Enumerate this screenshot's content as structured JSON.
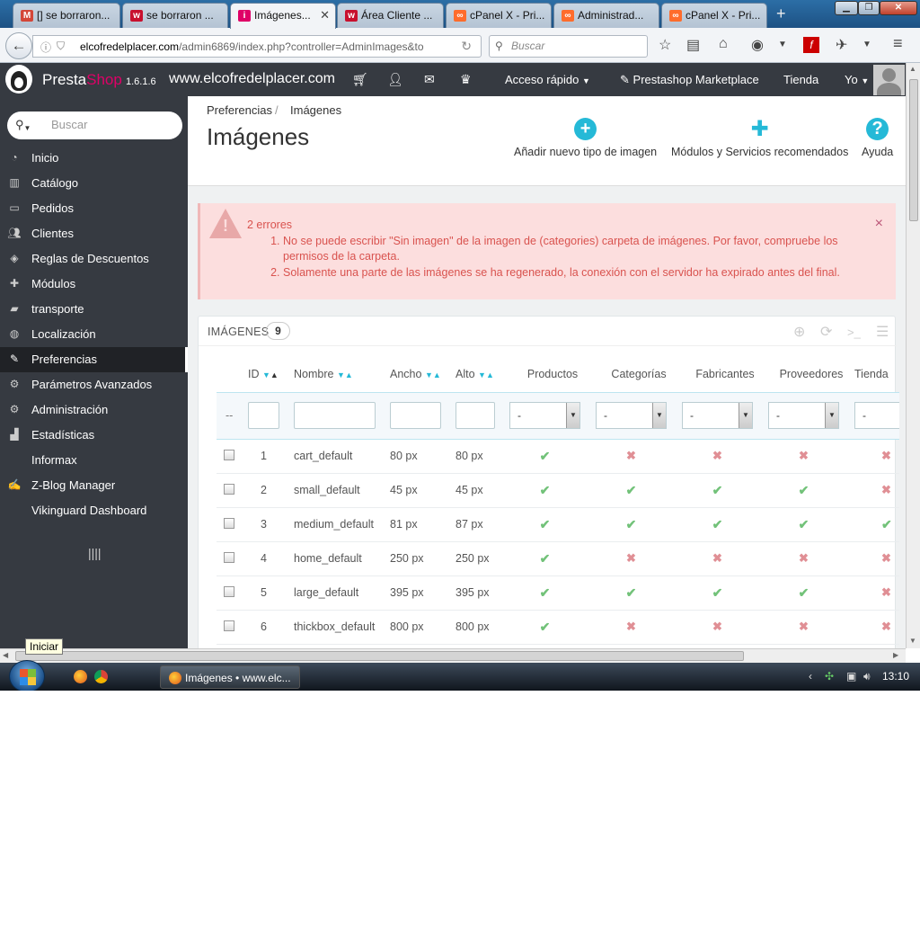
{
  "browser": {
    "tabs": [
      {
        "label": "[] se borraron...",
        "favicon": "gmail-icon",
        "color": "#d44638"
      },
      {
        "label": "se borraron ...",
        "favicon": "w-icon",
        "color": "#c8102e"
      },
      {
        "label": "Imágenes...",
        "favicon": "prestashop-icon",
        "color": "#df0067",
        "active": true
      },
      {
        "label": "Área Cliente ...",
        "favicon": "w-icon",
        "color": "#c8102e"
      },
      {
        "label": "cPanel X - Pri...",
        "favicon": "cpanel-icon",
        "color": "#ff6c2c"
      },
      {
        "label": "Administrad...",
        "favicon": "cpanel-icon",
        "color": "#ff6c2c"
      },
      {
        "label": "cPanel X - Pri...",
        "favicon": "cpanel-icon",
        "color": "#ff6c2c"
      }
    ],
    "url_domain": "elcofredelplacer.com",
    "url_path": "/admin6869/index.php?controller=AdminImages&to",
    "search_placeholder": "Buscar"
  },
  "header": {
    "brand_a": "Presta",
    "brand_b": "Shop",
    "version": "1.6.1.6",
    "site": "www.elcofredelplacer.com",
    "quick_access": "Acceso rápido",
    "marketplace": "Prestashop Marketplace",
    "store": "Tienda",
    "me": "Yo"
  },
  "sidebar": {
    "search_placeholder": "Buscar",
    "items": [
      {
        "label": "Inicio",
        "icon": "dashboard-icon"
      },
      {
        "label": "Catálogo",
        "icon": "book-icon"
      },
      {
        "label": "Pedidos",
        "icon": "credit-card-icon"
      },
      {
        "label": "Clientes",
        "icon": "users-icon"
      },
      {
        "label": "Reglas de Descuentos",
        "icon": "tags-icon"
      },
      {
        "label": "Módulos",
        "icon": "puzzle-icon"
      },
      {
        "label": "transporte",
        "icon": "truck-icon"
      },
      {
        "label": "Localización",
        "icon": "globe-icon"
      },
      {
        "label": "Preferencias",
        "icon": "wrench-icon",
        "active": true
      },
      {
        "label": "Parámetros Avanzados",
        "icon": "cogs-icon"
      },
      {
        "label": "Administración",
        "icon": "cog-icon"
      },
      {
        "label": "Estadísticas",
        "icon": "bar-chart-icon"
      },
      {
        "label": "Informax",
        "icon": ""
      },
      {
        "label": "Z-Blog Manager",
        "icon": "edit-icon"
      },
      {
        "label": "Vikinguard Dashboard",
        "icon": ""
      }
    ]
  },
  "page": {
    "breadcrumb": [
      "Preferencias",
      "Imágenes"
    ],
    "title": "Imágenes",
    "toolbar": {
      "add": "Añadir nuevo tipo de imagen",
      "modules": "Módulos y Servicios recomendados",
      "help": "Ayuda"
    }
  },
  "alert": {
    "count": "2 errores",
    "errors": [
      "No se puede escribir \"Sin imagen\" de la imagen de (categories) carpeta de imágenes. Por favor, compruebe los permisos de la carpeta.",
      "Solamente una parte de las imágenes se ha regenerado, la conexión con el servidor ha expirado antes del final."
    ]
  },
  "table": {
    "title": "IMÁGENES",
    "count": "9",
    "columns": [
      "ID",
      "Nombre",
      "Ancho",
      "Alto",
      "Productos",
      "Categorías",
      "Fabricantes",
      "Proveedores",
      "Tienda"
    ],
    "filter_dash": "--",
    "select_default": "-",
    "rows": [
      {
        "id": "1",
        "name": "cart_default",
        "width": "80 px",
        "height": "80 px",
        "flags": [
          true,
          false,
          false,
          false,
          false
        ]
      },
      {
        "id": "2",
        "name": "small_default",
        "width": "45 px",
        "height": "45 px",
        "flags": [
          true,
          true,
          true,
          true,
          false
        ]
      },
      {
        "id": "3",
        "name": "medium_default",
        "width": "81 px",
        "height": "87 px",
        "flags": [
          true,
          true,
          true,
          true,
          true
        ]
      },
      {
        "id": "4",
        "name": "home_default",
        "width": "250 px",
        "height": "250 px",
        "flags": [
          true,
          false,
          false,
          false,
          false
        ]
      },
      {
        "id": "5",
        "name": "large_default",
        "width": "395 px",
        "height": "395 px",
        "flags": [
          true,
          true,
          true,
          true,
          false
        ]
      },
      {
        "id": "6",
        "name": "thickbox_default",
        "width": "800 px",
        "height": "800 px",
        "flags": [
          true,
          false,
          false,
          false,
          false
        ]
      }
    ]
  },
  "status": {
    "tooltip": "Iniciar",
    "taskbar_app": "Imágenes • www.elc...",
    "clock": "13:10"
  },
  "colors": {
    "accent": "#25b9d7",
    "ok": "#72c279",
    "no": "#e08f95",
    "error": "#d9534f"
  }
}
